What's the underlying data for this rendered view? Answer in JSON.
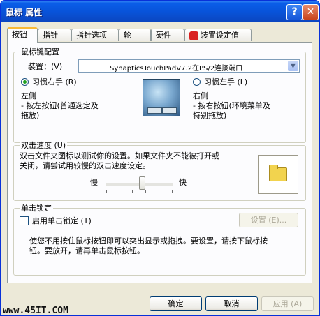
{
  "window": {
    "title": "鼠标 属性",
    "help_glyph": "?",
    "close_glyph": "✕"
  },
  "tabs": [
    {
      "label": "按钮"
    },
    {
      "label": "指针"
    },
    {
      "label": "指针选项"
    },
    {
      "label": "轮"
    },
    {
      "label": "硬件"
    },
    {
      "label": "装置设定值",
      "icon": "warning-icon"
    }
  ],
  "button_config": {
    "group_title": "鼠标键配置",
    "device_label": "装置：(V)",
    "device_value": "SynapticsTouchPadV7.2在PS/2连接端口",
    "right_hand_label": "习惯右手 (R)",
    "left_hand_label": "习惯左手 (L)",
    "left_side_title": "左侧",
    "left_side_desc_1": "- 按左按钮(普通选定及",
    "left_side_desc_2": "拖放)",
    "right_side_title": "右侧",
    "right_side_desc_1": "- 按右按钮(环境菜单及",
    "right_side_desc_2": "特别拖放)",
    "right_hand_selected": true
  },
  "double_click": {
    "group_title": "双击速度 (U)",
    "desc_1": "双击文件夹图标以测试你的设置。如果文件夹不能被打开或",
    "desc_2": "关闭，请尝试用较慢的双击速度设定。",
    "slow_label": "慢",
    "fast_label": "快",
    "speed_fraction": 0.55
  },
  "click_lock": {
    "group_title": "单击锁定",
    "checkbox_label": "启用单击锁定 (T)",
    "checked": false,
    "settings_button": "设置 (E)...",
    "desc_1": "使您不用按住鼠标按钮即可以突出显示或拖拽。要设置，请按下鼠标按",
    "desc_2": "钮。要放开，请再单击鼠标按钮。"
  },
  "footer": {
    "ok": "确定",
    "cancel": "取消",
    "apply": "应用 (A)"
  },
  "watermark": "www.45IT.COM",
  "colors": {
    "title_bar": "#0855dd",
    "panel": "#fcfcfe",
    "dialog": "#ece9d8"
  }
}
